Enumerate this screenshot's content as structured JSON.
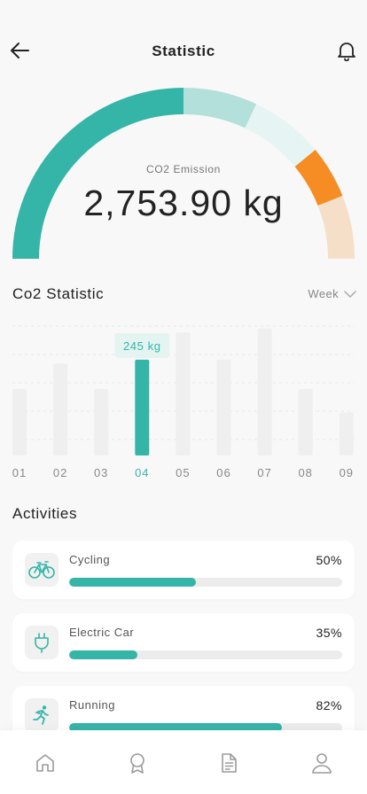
{
  "header": {
    "title": "Statistic"
  },
  "emission": {
    "label": "CO2 Emission",
    "value": "2,753.90 kg",
    "segments": [
      {
        "color": "#35b5a8",
        "share": 0.5
      },
      {
        "color": "#b3e0da",
        "share": 0.14
      },
      {
        "color": "#e6f5f3",
        "share": 0.14
      },
      {
        "color": "#f58c24",
        "share": 0.1
      },
      {
        "color": "#f5dfc9",
        "share": 0.12
      }
    ]
  },
  "statistic": {
    "title": "Co2 Statistic",
    "period": "Week"
  },
  "chart_data": {
    "type": "bar",
    "categories": [
      "01",
      "02",
      "03",
      "04",
      "05",
      "06",
      "07",
      "08",
      "09"
    ],
    "values": [
      170,
      235,
      170,
      245,
      315,
      245,
      325,
      170,
      110
    ],
    "ylim": [
      0,
      340
    ],
    "highlight_index": 3,
    "highlight_label": "245 kg",
    "colors": {
      "active": "#35b5a8",
      "bar": "#efefef",
      "grid": "#e7e7e7"
    }
  },
  "activities": {
    "title": "Activities",
    "items": [
      {
        "icon": "bicycle-icon",
        "label": "Cycling",
        "percent_text": "50%",
        "percent": 0.465
      },
      {
        "icon": "plug-icon",
        "label": "Electric Car",
        "percent_text": "35%",
        "percent": 0.25
      },
      {
        "icon": "running-icon",
        "label": "Running",
        "percent_text": "82%",
        "percent": 0.78
      }
    ]
  },
  "nav": [
    "home-icon",
    "award-icon",
    "document-icon",
    "profile-icon"
  ],
  "colors": {
    "accent": "#35b5a8",
    "orange": "#f58c24"
  }
}
